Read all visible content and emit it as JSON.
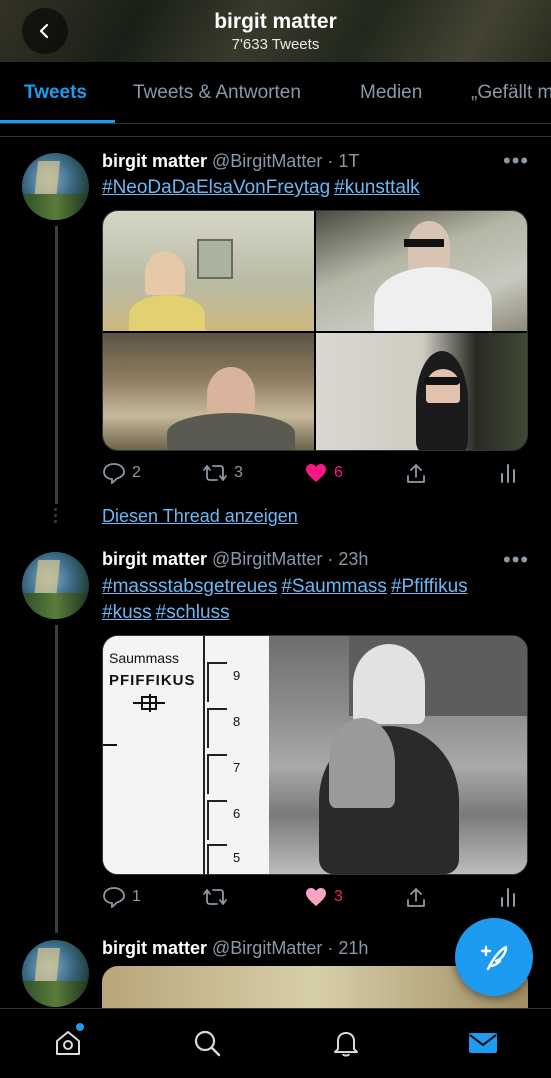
{
  "header": {
    "title": "birgit matter",
    "tweet_count": "7'633 Tweets",
    "back_icon": "chevron-left-icon"
  },
  "tabs": [
    {
      "label": "Tweets",
      "active": true
    },
    {
      "label": "Tweets & Antworten",
      "active": false
    },
    {
      "label": "Medien",
      "active": false
    },
    {
      "label": "„Gefällt mir“-Angaben",
      "active": false
    }
  ],
  "tweets": [
    {
      "name": "birgit matter",
      "meta": "@BirgitMatter · 1T",
      "hashtags": [
        "#NeoDaDaElsaVonFreytag",
        "#kunsttalk"
      ],
      "replies": "2",
      "retweets": "3",
      "likes": "6",
      "liked": true,
      "show_thread": "Diesen Thread anzeigen"
    },
    {
      "name": "birgit matter",
      "meta": "@BirgitMatter · 23h",
      "hashtags": [
        "#massstabsgetreues",
        "#Saummass",
        "#Pfiffikus",
        "#kuss",
        "#schluss"
      ],
      "media_labels": [
        "Saummass",
        "PFIFFIKUS"
      ],
      "ruler_numbers": [
        "9",
        "8",
        "7",
        "6",
        "5"
      ],
      "replies": "1",
      "retweets": "",
      "likes": "3",
      "liked": true
    },
    {
      "name": "birgit matter",
      "meta": "@BirgitMatter · 21h"
    }
  ],
  "fab": {
    "icon": "compose-tweet-icon"
  },
  "bottom_nav": [
    {
      "icon": "home-icon",
      "has_badge": true
    },
    {
      "icon": "search-icon"
    },
    {
      "icon": "bell-icon"
    },
    {
      "icon": "mail-icon",
      "active": true
    }
  ],
  "colors": {
    "accent": "#1d9bf0",
    "like": "#f91880",
    "muted": "#8b98a5",
    "background": "#000000"
  }
}
